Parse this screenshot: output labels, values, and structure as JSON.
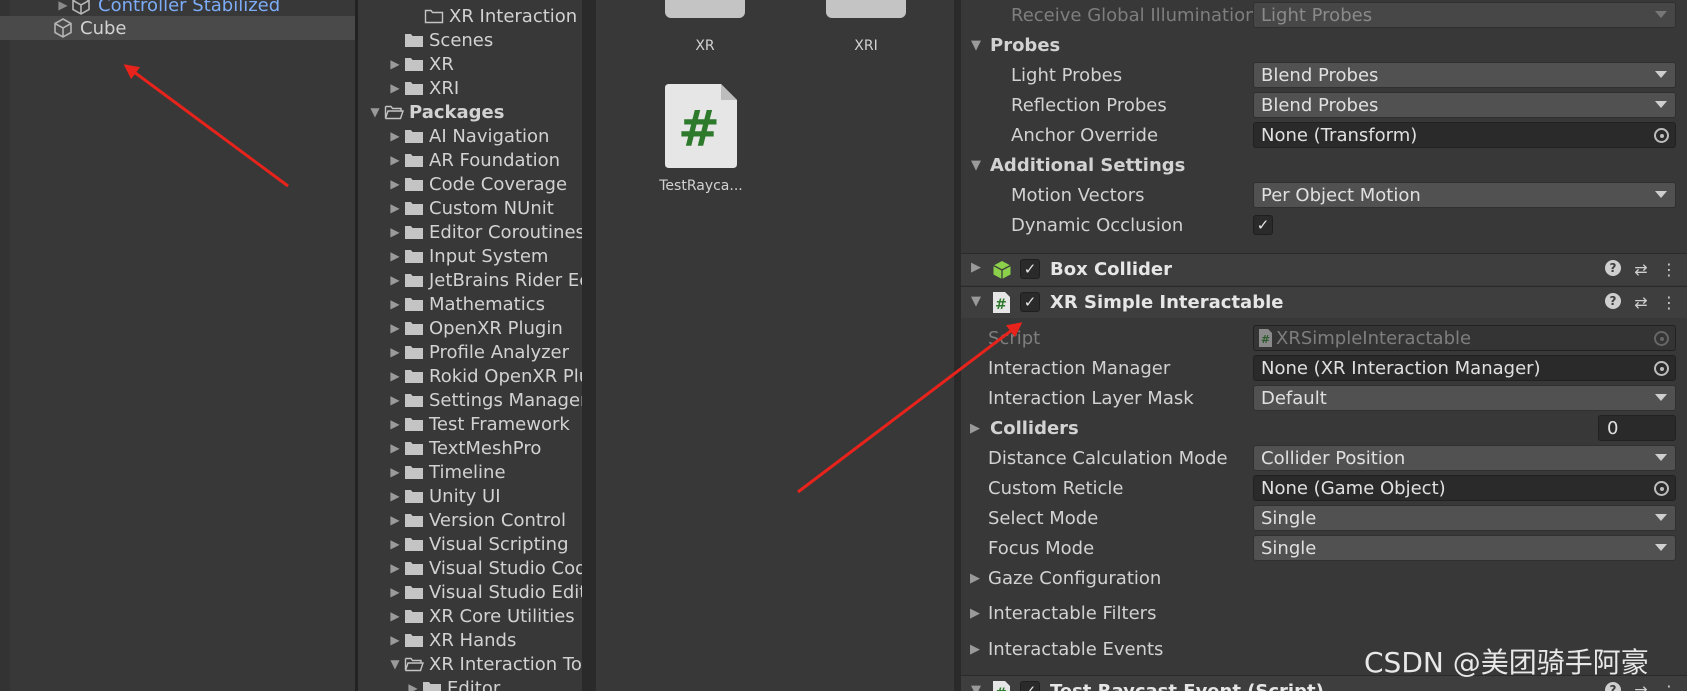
{
  "hierarchy": {
    "items": [
      {
        "label": "Controller Stabilized"
      },
      {
        "label": "Cube"
      }
    ]
  },
  "project_tree": {
    "items": [
      {
        "label": "XR Interaction T"
      },
      {
        "label": "Scenes"
      },
      {
        "label": "XR"
      },
      {
        "label": "XRI"
      },
      {
        "label": "Packages"
      },
      {
        "label": "AI Navigation"
      },
      {
        "label": "AR Foundation"
      },
      {
        "label": "Code Coverage"
      },
      {
        "label": "Custom NUnit"
      },
      {
        "label": "Editor Coroutines"
      },
      {
        "label": "Input System"
      },
      {
        "label": "JetBrains Rider Ec"
      },
      {
        "label": "Mathematics"
      },
      {
        "label": "OpenXR Plugin"
      },
      {
        "label": "Profile Analyzer"
      },
      {
        "label": "Rokid OpenXR Plu"
      },
      {
        "label": "Settings Manager"
      },
      {
        "label": "Test Framework"
      },
      {
        "label": "TextMeshPro"
      },
      {
        "label": "Timeline"
      },
      {
        "label": "Unity UI"
      },
      {
        "label": "Version Control"
      },
      {
        "label": "Visual Scripting"
      },
      {
        "label": "Visual Studio Cod"
      },
      {
        "label": "Visual Studio Edit"
      },
      {
        "label": "XR Core Utilities"
      },
      {
        "label": "XR Hands"
      },
      {
        "label": "XR Interaction Toc"
      },
      {
        "label": "Editor"
      }
    ]
  },
  "assets": {
    "items": [
      {
        "label": "XR"
      },
      {
        "label": "XRI"
      },
      {
        "label": "TestRayca..."
      }
    ],
    "script_glyph": "#"
  },
  "inspector": {
    "receive_gi": {
      "label": "Receive Global Illumination",
      "value": "Light Probes"
    },
    "probes": {
      "label": "Probes"
    },
    "light_probes": {
      "label": "Light Probes",
      "value": "Blend Probes"
    },
    "reflection_probes": {
      "label": "Reflection Probes",
      "value": "Blend Probes"
    },
    "anchor_override": {
      "label": "Anchor Override",
      "value": "None (Transform)"
    },
    "additional_settings": {
      "label": "Additional Settings"
    },
    "motion_vectors": {
      "label": "Motion Vectors",
      "value": "Per Object Motion"
    },
    "dynamic_occlusion": {
      "label": "Dynamic Occlusion",
      "check": "✓"
    },
    "box_collider": {
      "label": "Box Collider",
      "check": "✓"
    },
    "xr_simple_interactable": {
      "label": "XR Simple Interactable",
      "check": "✓"
    },
    "script": {
      "label": "Script",
      "value": "XRSimpleInteractable"
    },
    "interaction_manager": {
      "label": "Interaction Manager",
      "value": "None (XR Interaction Manager)"
    },
    "interaction_layer_mask": {
      "label": "Interaction Layer Mask",
      "value": "Default"
    },
    "colliders": {
      "label": "Colliders",
      "value": "0"
    },
    "distance_calc": {
      "label": "Distance Calculation Mode",
      "value": "Collider Position"
    },
    "custom_reticle": {
      "label": "Custom Reticle",
      "value": "None (Game Object)"
    },
    "select_mode": {
      "label": "Select Mode",
      "value": "Single"
    },
    "focus_mode": {
      "label": "Focus Mode",
      "value": "Single"
    },
    "gaze_configuration": {
      "label": "Gaze Configuration"
    },
    "interactable_filters": {
      "label": "Interactable Filters"
    },
    "interactable_events": {
      "label": "Interactable Events"
    },
    "test_raycast_event": {
      "label": "Test Raycast Event (Script)",
      "check": "✓"
    }
  },
  "watermark": "CSDN @美团骑手阿豪",
  "colors": {
    "annotation_arrow": "#e8231b",
    "background": "#383838",
    "link_blue": "#7cacf8",
    "script_green": "#2d7a2d"
  },
  "icons": {
    "cube": "cube-icon",
    "folder": "folder-icon",
    "script": "script-hash-icon",
    "box_collider": "box-collider-icon",
    "help": "help-icon",
    "presets": "presets-icon",
    "more": "more-icon"
  }
}
